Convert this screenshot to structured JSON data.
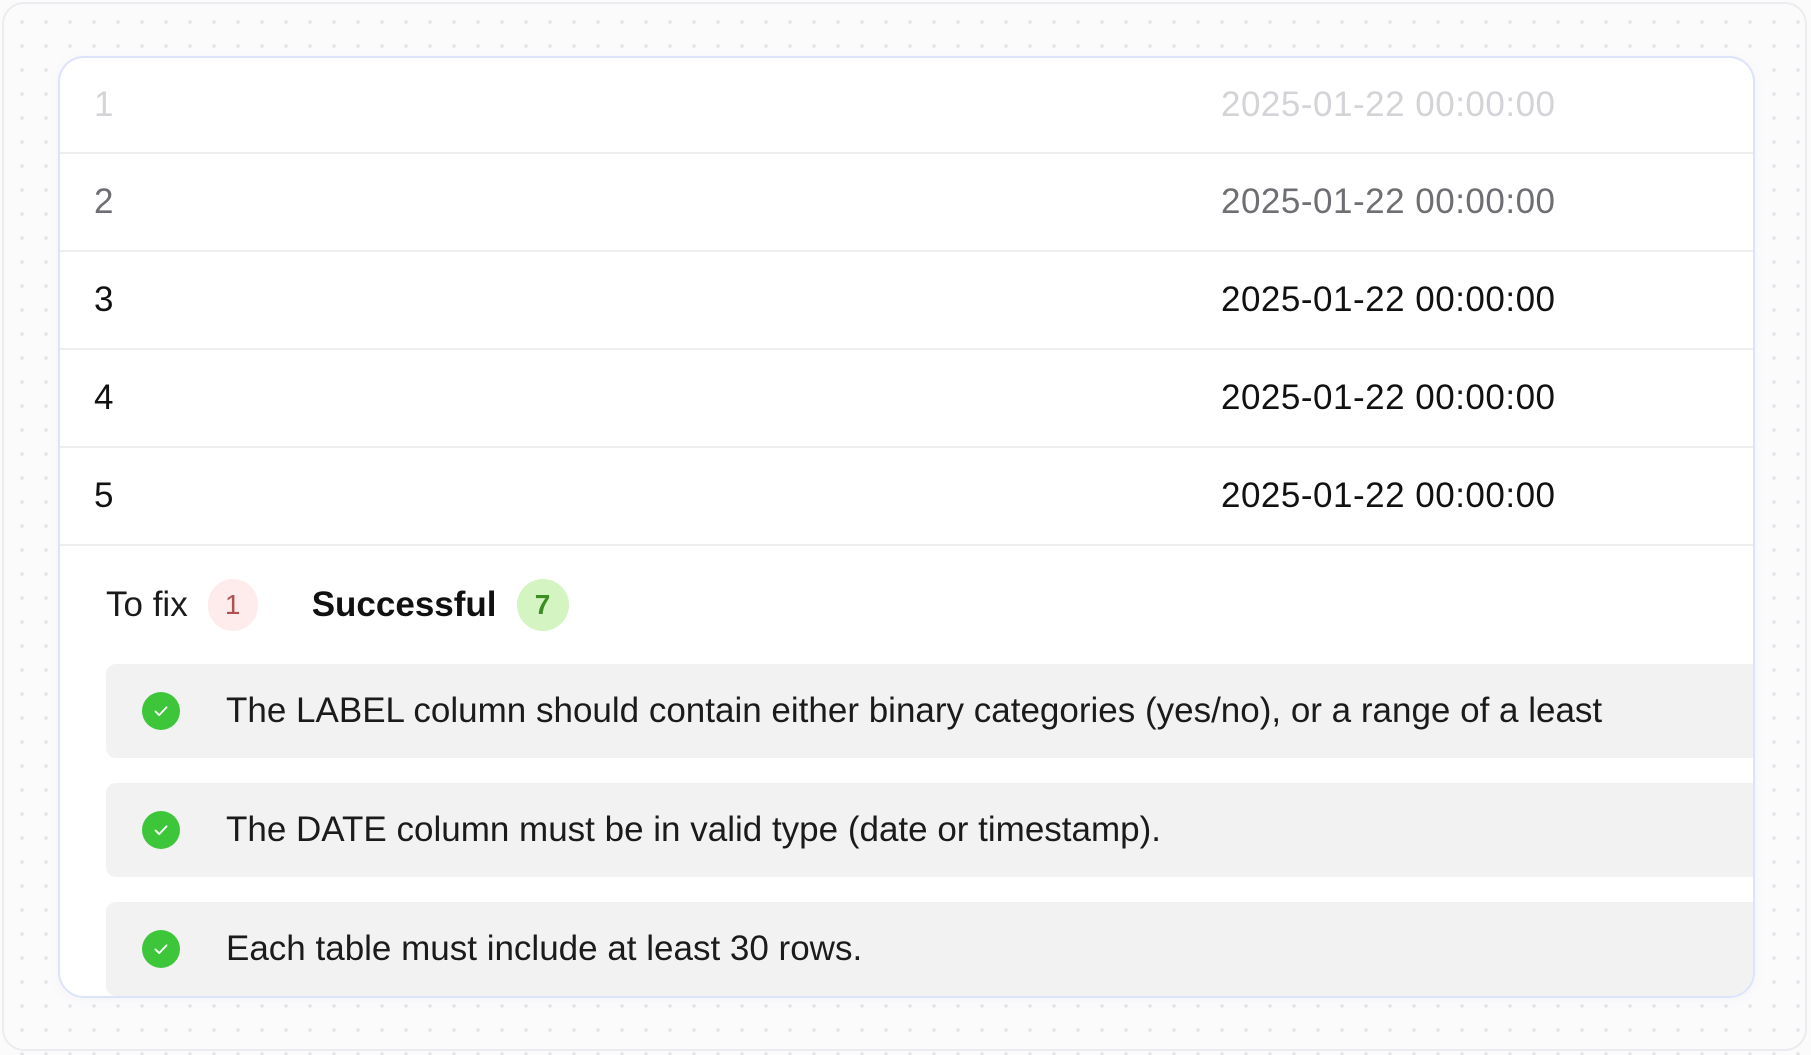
{
  "table": {
    "rows": [
      {
        "index": "1",
        "date": "2025-01-22 00:00:00",
        "color": "#d4d4d8"
      },
      {
        "index": "2",
        "date": "2025-01-22 00:00:00",
        "color": "#6e6e73"
      },
      {
        "index": "3",
        "date": "2025-01-22 00:00:00",
        "color": "#111111"
      },
      {
        "index": "4",
        "date": "2025-01-22 00:00:00",
        "color": "#111111"
      },
      {
        "index": "5",
        "date": "2025-01-22 00:00:00",
        "color": "#111111"
      }
    ]
  },
  "tabs": {
    "to_fix": {
      "label": "To fix",
      "count": "1"
    },
    "successful": {
      "label": "Successful",
      "count": "7",
      "active": true
    }
  },
  "checks": [
    {
      "text": "The LABEL column should contain either binary categories (yes/no), or a range of a least",
      "status": "passed",
      "icon": "check-circle-icon"
    },
    {
      "text": "The DATE column must be in valid type (date or timestamp).",
      "status": "passed",
      "icon": "check-circle-icon"
    },
    {
      "text": "Each table must include at least 30 rows.",
      "status": "passed",
      "icon": "check-circle-icon"
    }
  ],
  "colors": {
    "success_green": "#3ec63a",
    "badge_fix_bg": "#fdeceb",
    "badge_success_bg": "#d4f4c2",
    "card_border": "#dde3fb"
  }
}
